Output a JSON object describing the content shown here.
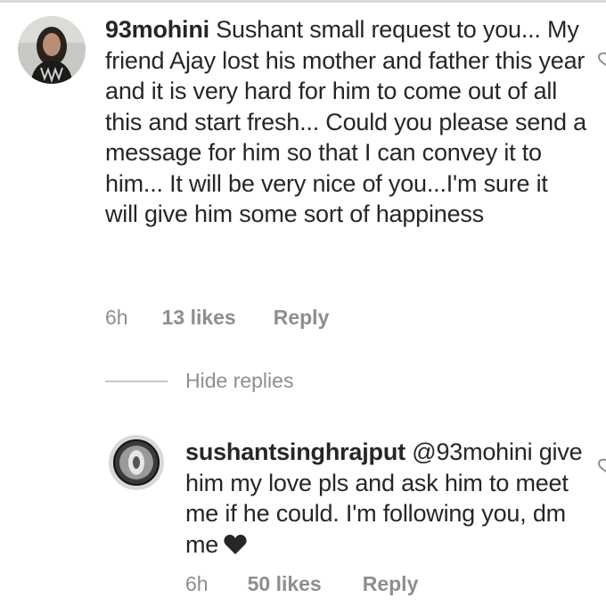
{
  "comment": {
    "username": "93mohini",
    "text": "Sushant small request to you... My friend Ajay lost his mother and father this year and it is very hard for him to come out of all this and start fresh... Could you please send a message for him so that I can convey it to him... It will be very nice of you...I'm sure it will give him some sort of happiness",
    "time": "6h",
    "likes": "13 likes",
    "reply_label": "Reply"
  },
  "hide_replies_label": "Hide replies",
  "reply": {
    "username": "sushantsinghrajput",
    "mention": "@93mohini",
    "text": "give him my love pls and ask him to meet me if he could. I'm following you, dm me",
    "time": "6h",
    "likes": "50 likes",
    "reply_label": "Reply"
  },
  "icons": {
    "like": "heart-outline-icon",
    "inline": "heart-filled-icon"
  }
}
